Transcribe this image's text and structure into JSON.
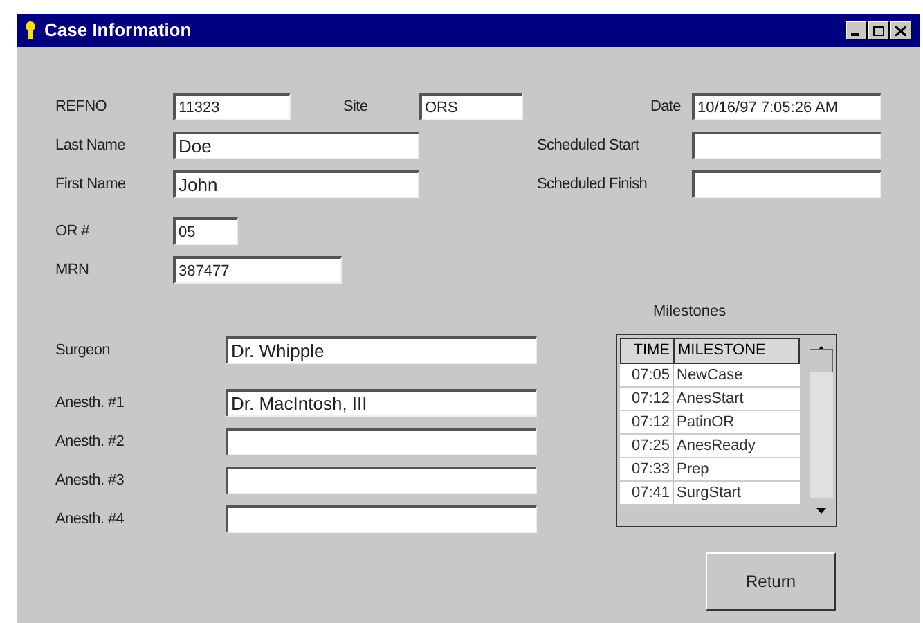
{
  "window": {
    "title": "Case Information"
  },
  "top_rows": [
    [
      {
        "label": "REFNO",
        "value": "11323"
      },
      {
        "label": "Site",
        "value": "ORS"
      },
      {
        "label": "Date",
        "value": "10/16/97 7:05:26 AM"
      }
    ],
    [
      {
        "label": "Last Name",
        "value": "Doe"
      },
      {
        "label": "Scheduled Start"
      }
    ],
    [
      {
        "label": "First Name",
        "value": "John"
      },
      {
        "label": "Scheduled Finish"
      }
    ]
  ],
  "id_fields": [
    {
      "label": "OR #",
      "value": "05"
    },
    {
      "label": "MRN",
      "value": "387477"
    }
  ],
  "staff_fields": [
    {
      "label": "Surgeon",
      "value": "Dr. Whipple"
    },
    {
      "label": "Anesth. #1",
      "value": "Dr. MacIntosh, III"
    },
    {
      "label": "Anesth. #2"
    },
    {
      "label": "Anesth. #3"
    },
    {
      "label": "Anesth. #4"
    }
  ],
  "milestones": {
    "title": "Milestones",
    "columns": [
      "TIME",
      "MILESTONE"
    ],
    "rows": [
      {
        "time": "07:05",
        "milestone": "NewCase"
      },
      {
        "time": "07:12",
        "milestone": "AnesStart"
      },
      {
        "time": "07:12",
        "milestone": "PatinOR"
      },
      {
        "time": "07:25",
        "milestone": "AnesReady"
      },
      {
        "time": "07:33",
        "milestone": "Prep"
      },
      {
        "time": "07:41",
        "milestone": "SurgStart"
      }
    ]
  },
  "buttons": [
    "Return"
  ]
}
